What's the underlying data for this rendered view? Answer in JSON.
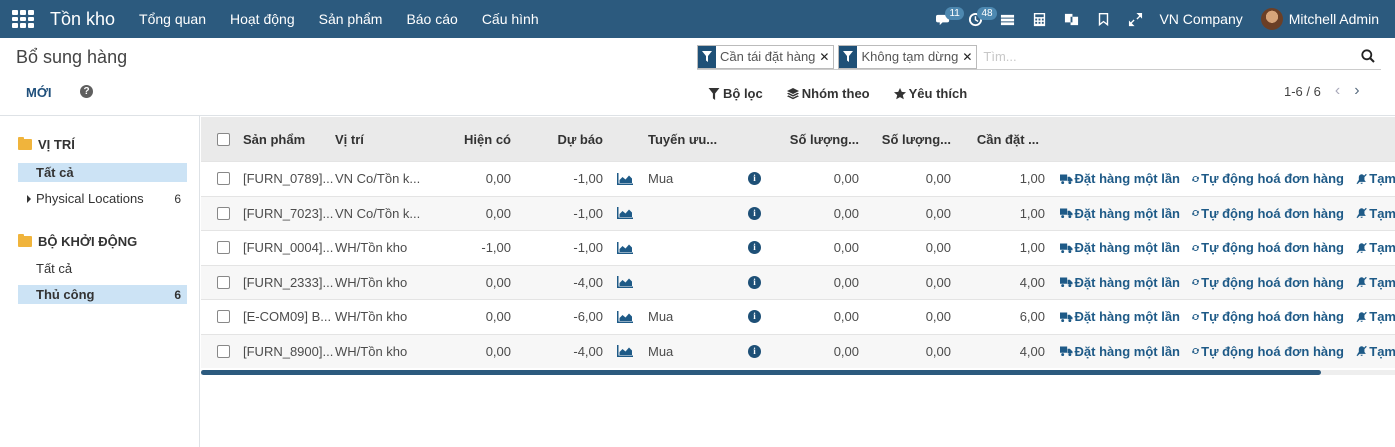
{
  "topbar": {
    "app_name": "Tồn kho",
    "menu": [
      "Tổng quan",
      "Hoạt động",
      "Sản phẩm",
      "Báo cáo",
      "Cấu hình"
    ],
    "messages_count": "11",
    "activities_count": "48",
    "company": "VN Company",
    "user": "Mitchell Admin"
  },
  "control": {
    "breadcrumb": "Bổ sung hàng",
    "new_label": "MỚI",
    "facets": [
      "Cần tái đặt hàng",
      "Không tạm dừng"
    ],
    "search_placeholder": "Tìm...",
    "filter_label": "Bộ lọc",
    "group_label": "Nhóm theo",
    "fav_label": "Yêu thích",
    "pager": "1-6 / 6"
  },
  "side": {
    "location_header": "VỊ TRÍ",
    "location_items": [
      {
        "label": "Tất cả",
        "count": ""
      },
      {
        "label": "Physical Locations",
        "count": "6"
      }
    ],
    "trigger_header": "BỘ KHỞI ĐỘNG",
    "trigger_items": [
      {
        "label": "Tất cả",
        "count": ""
      },
      {
        "label": "Thủ công",
        "count": "6"
      }
    ]
  },
  "table": {
    "columns": [
      "Sản phẩm",
      "Vị trí",
      "Hiện có",
      "Dự báo",
      "Tuyến ưu...",
      "Số lượng...",
      "Số lượng...",
      "Cần đặt ..."
    ],
    "rows": [
      {
        "product": "[FURN_0789]...",
        "location": "VN Co/Tồn k...",
        "onhand": "0,00",
        "forecast": "-1,00",
        "route": "Mua",
        "min": "0,00",
        "max": "0,00",
        "order": "1,00"
      },
      {
        "product": "[FURN_7023]...",
        "location": "VN Co/Tồn k...",
        "onhand": "0,00",
        "forecast": "-1,00",
        "route": "",
        "min": "0,00",
        "max": "0,00",
        "order": "1,00"
      },
      {
        "product": "[FURN_0004]...",
        "location": "WH/Tồn kho",
        "onhand": "-1,00",
        "forecast": "-1,00",
        "route": "",
        "min": "0,00",
        "max": "0,00",
        "order": "1,00"
      },
      {
        "product": "[FURN_2333]...",
        "location": "WH/Tồn kho",
        "onhand": "0,00",
        "forecast": "-4,00",
        "route": "",
        "min": "0,00",
        "max": "0,00",
        "order": "4,00"
      },
      {
        "product": "[E-COM09] B...",
        "location": "WH/Tồn kho",
        "onhand": "0,00",
        "forecast": "-6,00",
        "route": "Mua",
        "min": "0,00",
        "max": "0,00",
        "order": "6,00"
      },
      {
        "product": "[FURN_8900]...",
        "location": "WH/Tồn kho",
        "onhand": "0,00",
        "forecast": "-4,00",
        "route": "Mua",
        "min": "0,00",
        "max": "0,00",
        "order": "4,00"
      }
    ],
    "action_order_once": "Đặt hàng một lần",
    "action_automate": "Tự động hoá đơn hàng",
    "action_snooze": "Tạm"
  }
}
